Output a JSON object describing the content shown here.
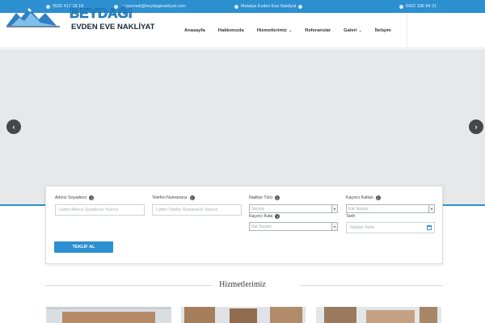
{
  "topbar": {
    "phone": "0532 417 18 18",
    "email": "satourmeli@beydaginakliyat.com",
    "location": "Malatya Evden Eve Nakliyat",
    "phone2": "0422 336 84 21"
  },
  "logo": {
    "brand": "BEYDAĞI",
    "tagline": "EVDEN EVE NAKLİYAT"
  },
  "nav": {
    "items": [
      {
        "label": "Anasayfa"
      },
      {
        "label": "Hakkımızda"
      },
      {
        "label": "Hizmetlerimiz",
        "has_dropdown": true
      },
      {
        "label": "Referanslar"
      },
      {
        "label": "Galeri",
        "has_dropdown": true
      },
      {
        "label": "İletişim"
      }
    ]
  },
  "slider": {
    "prev_icon": "chevron-left-icon",
    "next_icon": "chevron-right-icon"
  },
  "form": {
    "name_label": "Adınız Soyadınız",
    "name_placeholder": "Lütfen Adınızı Soyadınızı Yazınız",
    "phone_label": "Telefon Numaranız",
    "phone_placeholder": "Lütfen Telefon Numaranızı Yazınız",
    "type_label": "Nakliye Türü",
    "type_value": "Seçiniz",
    "from_floor_label": "Kaçıncı Kattan",
    "from_floor_value": "Kat Seçiniz",
    "to_floor_label": "Kaçıncı Kata",
    "to_floor_value": "Kat Seçiniz",
    "date_label": "Tarih",
    "date_placeholder": "Nakliye Tarihi",
    "submit_label": "TEKLİF AL"
  },
  "services": {
    "title": "Hizmetlerimiz"
  },
  "colors": {
    "primary": "#2c8fd0",
    "slider_bg": "#e7e8e9",
    "arrow_bg": "#454749"
  }
}
